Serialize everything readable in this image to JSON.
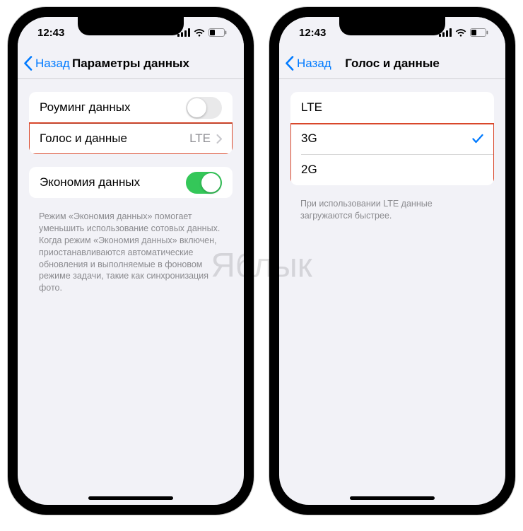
{
  "watermark": "Яблык",
  "status": {
    "time": "12:43"
  },
  "left": {
    "nav": {
      "back": "Назад",
      "title": "Параметры данных"
    },
    "group1": {
      "roaming_label": "Роуминг данных",
      "roaming_on": false,
      "voice_data_label": "Голос и данные",
      "voice_data_value": "LTE"
    },
    "group2": {
      "low_data_label": "Экономия данных",
      "low_data_on": true
    },
    "footer": "Режим «Экономия данных» помогает уменьшить использование сотовых данных. Когда режим «Экономия данных» включен, приостанавливаются автоматические обновления и выполняемые в фоновом режиме задачи, такие как синхронизация фото."
  },
  "right": {
    "nav": {
      "back": "Назад",
      "title": "Голос и данные"
    },
    "options": [
      {
        "label": "LTE",
        "selected": false
      },
      {
        "label": "3G",
        "selected": true
      },
      {
        "label": "2G",
        "selected": false
      }
    ],
    "footer": "При использовании LTE данные загружаются быстрее."
  }
}
